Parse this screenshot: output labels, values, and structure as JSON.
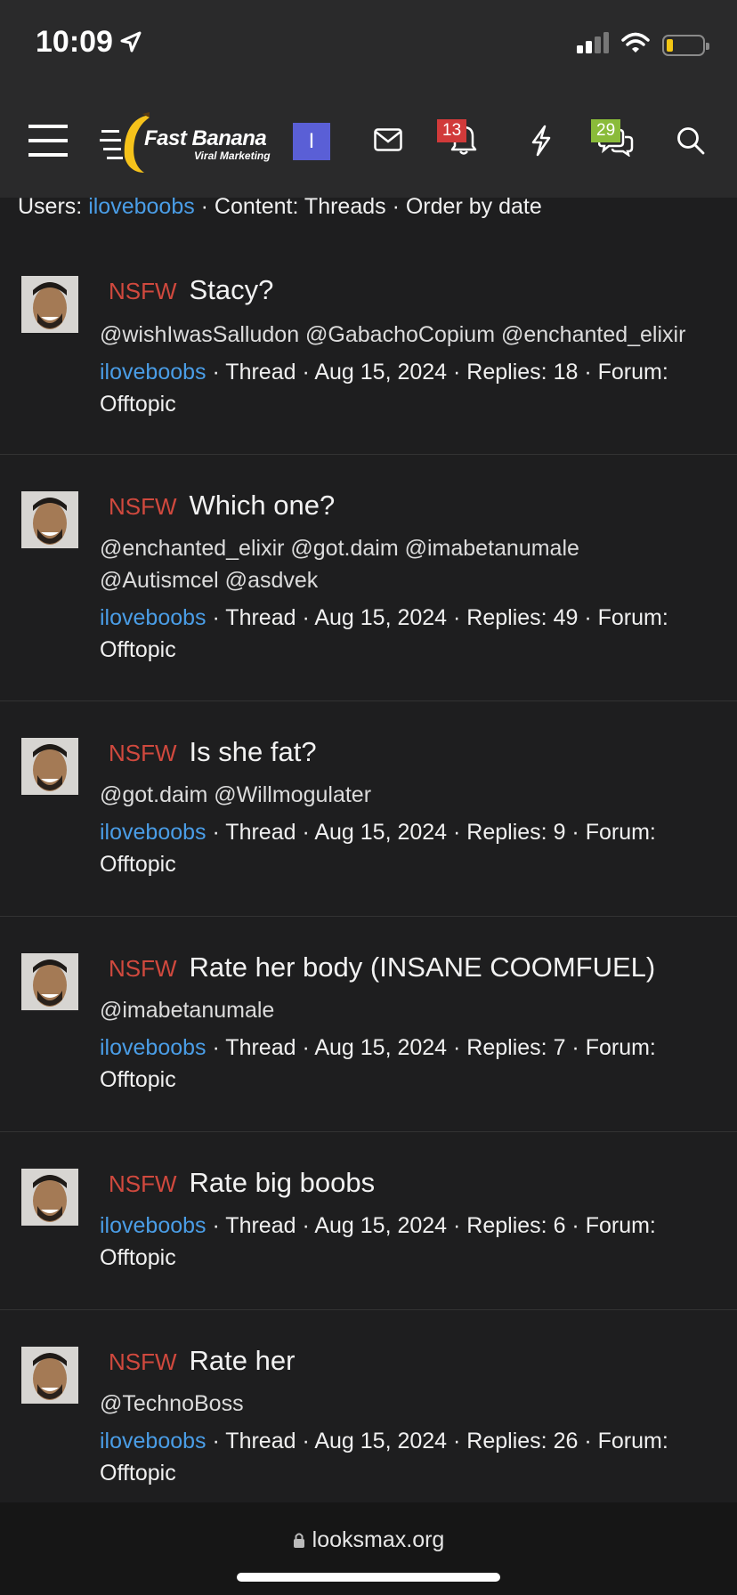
{
  "status": {
    "time": "10:09"
  },
  "header": {
    "logo_title": "Fast Banana",
    "logo_sub": "Viral Marketing",
    "user_initial": "I",
    "alerts_count": "13",
    "conversations_count": "29"
  },
  "filter": {
    "users_label": "Users:",
    "user": "iloveboobs",
    "rest": " · Content: Threads · Order by date"
  },
  "threads": [
    {
      "tag": "NSFW",
      "title": "Stacy?",
      "mentions": "@wishIwasSalludon @GabachoCopium @enchanted_elixir",
      "author": "iloveboobs",
      "meta": " · Thread · Aug 15, 2024 · Replies: 18 · Forum: Offtopic"
    },
    {
      "tag": "NSFW",
      "title": "Which one?",
      "mentions": "@enchanted_elixir @got.daim @imabetanumale @Autismcel @asdvek",
      "author": "iloveboobs",
      "meta": " · Thread · Aug 15, 2024 · Replies: 49 · Forum: Offtopic"
    },
    {
      "tag": "NSFW",
      "title": "Is she fat?",
      "mentions": "@got.daim @Willmogulater",
      "author": "iloveboobs",
      "meta": " · Thread · Aug 15, 2024 · Replies: 9 · Forum: Offtopic"
    },
    {
      "tag": "NSFW",
      "title": "Rate her body (INSANE COOMFUEL)",
      "mentions": "@imabetanumale",
      "author": "iloveboobs",
      "meta": " · Thread · Aug 15, 2024 · Replies: 7 · Forum: Offtopic"
    },
    {
      "tag": "NSFW",
      "title": "Rate big boobs",
      "mentions": "",
      "author": "iloveboobs",
      "meta": " · Thread · Aug 15, 2024 · Replies: 6 · Forum: Offtopic"
    },
    {
      "tag": "NSFW",
      "title": "Rate her",
      "mentions": "@TechnoBoss",
      "author": "iloveboobs",
      "meta": " · Thread · Aug 15, 2024 · Replies: 26 · Forum: Offtopic"
    }
  ],
  "browser": {
    "url": "looksmax.org"
  }
}
